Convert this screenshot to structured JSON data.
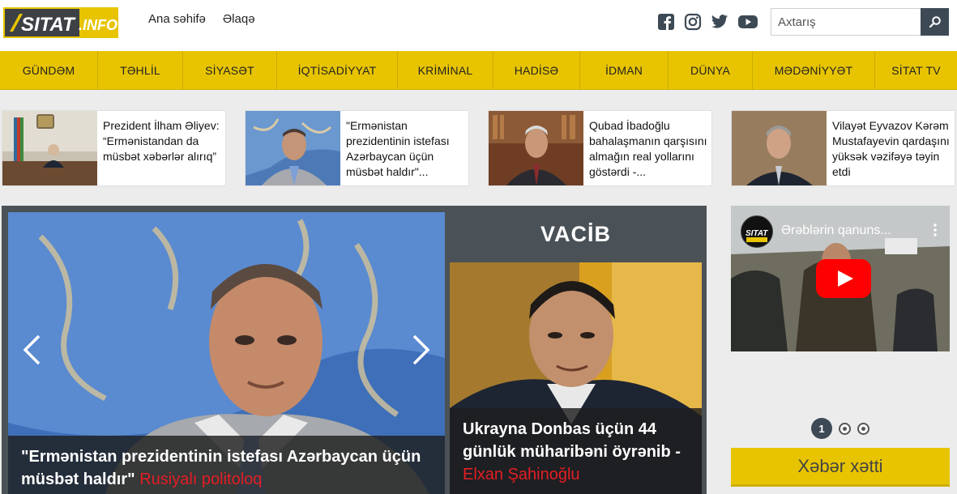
{
  "brand": {
    "logo_text": "SITAT",
    "logo_suffix": ".INFO",
    "accent": "#e8c400"
  },
  "topnav": [
    {
      "label": "Ana səhifə"
    },
    {
      "label": "Əlaqə"
    }
  ],
  "social": [
    "facebook-icon",
    "instagram-icon",
    "twitter-icon",
    "youtube-icon"
  ],
  "search": {
    "placeholder": "Axtarış"
  },
  "categories": [
    {
      "label": "GÜNDƏM"
    },
    {
      "label": "TƏHLİL"
    },
    {
      "label": "SİYASƏT"
    },
    {
      "label": "İQTİSADİYYAT"
    },
    {
      "label": "KRİMİNAL"
    },
    {
      "label": "HADİSƏ"
    },
    {
      "label": "İDMAN"
    },
    {
      "label": "DÜNYA"
    },
    {
      "label": "MƏDƏNİYYƏT"
    },
    {
      "label": "SİTAT TV"
    }
  ],
  "cards": [
    {
      "text": "Prezident İlham Əliyev: “Ermənistandan da müsbət xəbərlər alırıq”"
    },
    {
      "text": "\"Ermənistan prezidentinin istefası Azərbaycan üçün müsbət haldır\"..."
    },
    {
      "text": "Qubad İbadoğlu bahalaşmanın qarşısını almağın real yollarını göstərdi -..."
    },
    {
      "text": "Vilayət Eyvazov Kərəm Mustafayevin qardaşını yüksək vəzifəyə təyin etdi"
    }
  ],
  "slider": {
    "headline": "\"Ermənistan prezidentinin istefası Azərbaycan üçün müsbət haldır\"",
    "source": "Rusiyalı politoloq"
  },
  "vacib": {
    "title": "VACİB",
    "headline": "Ukrayna Donbas üçün 44 günlük müharibəni öyrənib -",
    "source": "Elxan Şahinoğlu"
  },
  "video": {
    "title": "Ərəblərin qanuns...",
    "channel_badge": "SITAT INFO"
  },
  "pager": {
    "current": "1"
  },
  "newsline": {
    "label": "Xəbər xətti"
  }
}
